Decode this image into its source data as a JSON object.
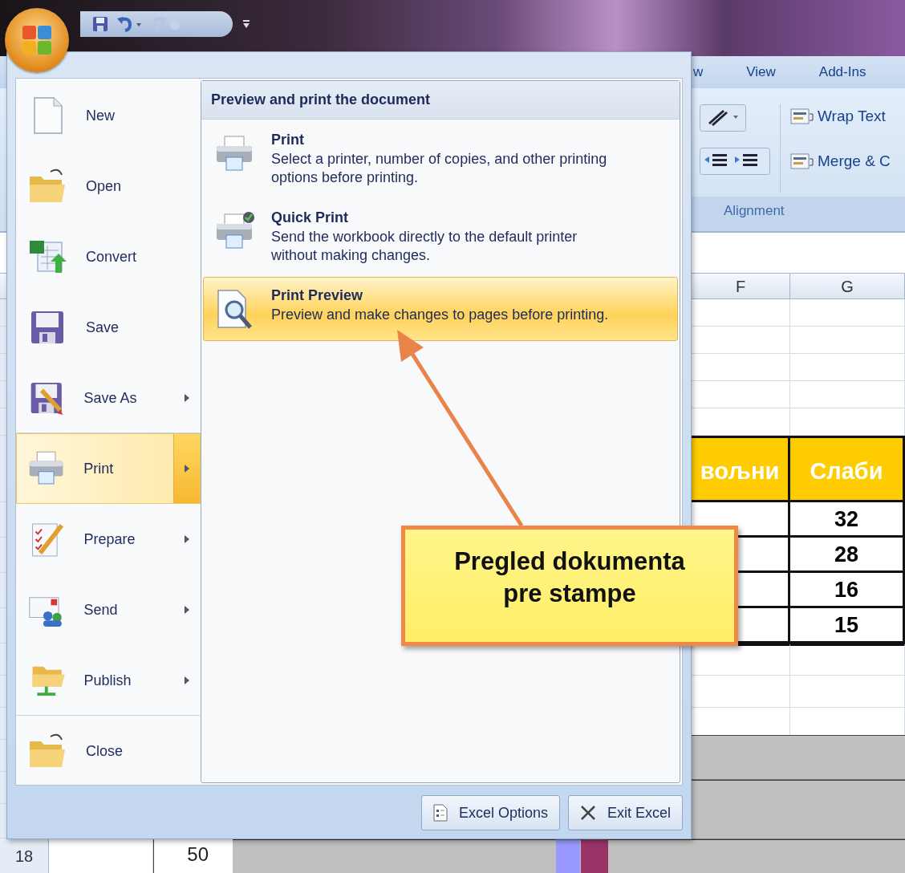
{
  "ribbon": {
    "tabs": [
      {
        "label": "w",
        "selected": false
      },
      {
        "label": "View",
        "selected": false
      },
      {
        "label": "Add-Ins",
        "selected": false
      }
    ],
    "group": {
      "buttons": [
        "Wrap Text",
        "Merge & C"
      ],
      "title": "Alignment"
    }
  },
  "sheet": {
    "columns": [
      "F",
      "G"
    ],
    "header": [
      "вољни",
      "Слаби"
    ],
    "rows": [
      [
        "32"
      ],
      [
        "28"
      ],
      [
        "16"
      ],
      [
        "15"
      ]
    ],
    "row_number": "18",
    "chart_axis_label": "50"
  },
  "office_menu": {
    "items": [
      {
        "label": "New",
        "submenu": false,
        "selected": false,
        "divider_after": false
      },
      {
        "label": "Open",
        "submenu": false,
        "selected": false,
        "divider_after": false
      },
      {
        "label": "Convert",
        "submenu": false,
        "selected": false,
        "divider_after": false
      },
      {
        "label": "Save",
        "submenu": false,
        "selected": false,
        "divider_after": false
      },
      {
        "label": "Save As",
        "submenu": true,
        "selected": false,
        "divider_after": true
      },
      {
        "label": "Print",
        "submenu": true,
        "selected": true,
        "divider_after": false
      },
      {
        "label": "Prepare",
        "submenu": true,
        "selected": false,
        "divider_after": false
      },
      {
        "label": "Send",
        "submenu": true,
        "selected": false,
        "divider_after": false
      },
      {
        "label": "Publish",
        "submenu": true,
        "selected": false,
        "divider_after": true
      },
      {
        "label": "Close",
        "submenu": false,
        "selected": false,
        "divider_after": false
      }
    ],
    "panel": {
      "title": "Preview and print the document",
      "options": [
        {
          "title": "Print",
          "description": "Select a printer, number of copies, and other printing options before printing.",
          "selected": false
        },
        {
          "title": "Quick Print",
          "description": "Send the workbook directly to the default printer without making changes.",
          "selected": false
        },
        {
          "title": "Print Preview",
          "description": "Preview and make changes to pages before printing.",
          "selected": true
        }
      ]
    },
    "buttons": [
      "Excel Options",
      "Exit Excel"
    ]
  },
  "callout": {
    "text": "Pregled dokumenta pre stampe"
  }
}
